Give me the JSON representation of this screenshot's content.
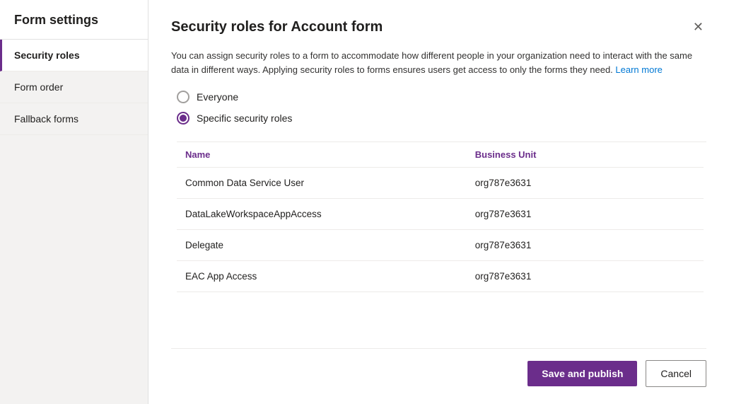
{
  "sidebar": {
    "title": "Form settings",
    "items": [
      {
        "id": "security-roles",
        "label": "Security roles",
        "active": true
      },
      {
        "id": "form-order",
        "label": "Form order",
        "active": false
      },
      {
        "id": "fallback-forms",
        "label": "Fallback forms",
        "active": false
      }
    ]
  },
  "dialog": {
    "title": "Security roles for Account form",
    "description": "You can assign security roles to a form to accommodate how different people in your organization need to interact with the same data in different ways. Applying security roles to forms ensures users get access to only the forms they need.",
    "learn_more_label": "Learn more",
    "radio_options": [
      {
        "id": "everyone",
        "label": "Everyone",
        "checked": false
      },
      {
        "id": "specific",
        "label": "Specific security roles",
        "checked": true
      }
    ],
    "table": {
      "columns": [
        {
          "key": "name",
          "label": "Name"
        },
        {
          "key": "business_unit",
          "label": "Business Unit"
        }
      ],
      "rows": [
        {
          "name": "Common Data Service User",
          "business_unit": "org787e3631"
        },
        {
          "name": "DataLakeWorkspaceAppAccess",
          "business_unit": "org787e3631"
        },
        {
          "name": "Delegate",
          "business_unit": "org787e3631"
        },
        {
          "name": "EAC App Access",
          "business_unit": "org787e3631"
        }
      ]
    },
    "close_label": "✕",
    "save_label": "Save and publish",
    "cancel_label": "Cancel"
  },
  "colors": {
    "accent": "#6b2d8b",
    "link": "#0078d4"
  }
}
